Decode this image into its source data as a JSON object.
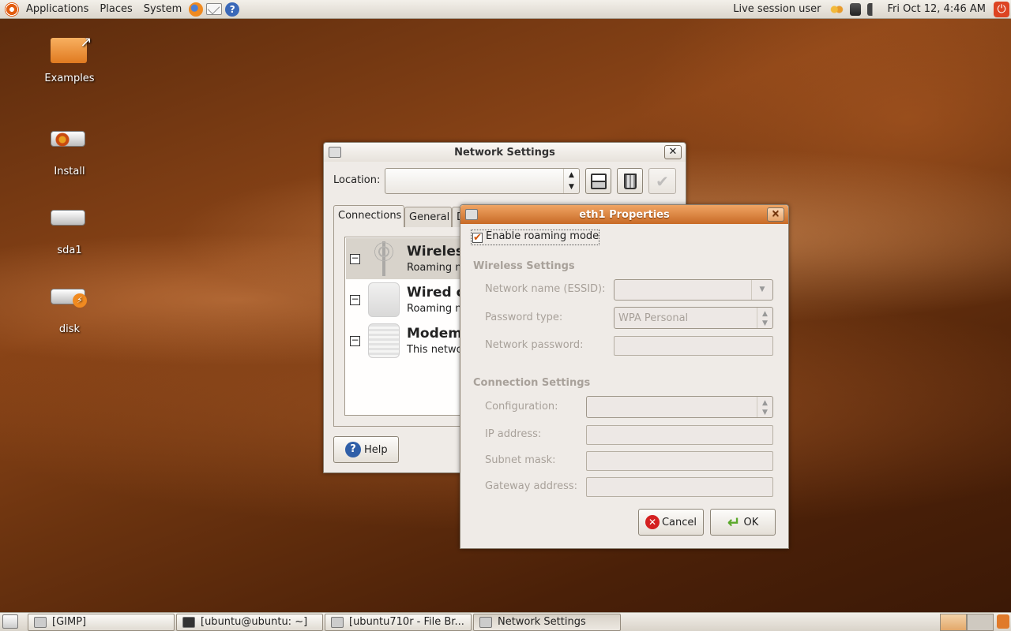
{
  "top_panel": {
    "menus": [
      "Applications",
      "Places",
      "System"
    ],
    "user_label": "Live session user",
    "clock": "Fri Oct 12,  4:46 AM"
  },
  "desktop": {
    "icons": [
      {
        "label": "Examples"
      },
      {
        "label": "Install"
      },
      {
        "label": "sda1"
      },
      {
        "label": "disk"
      }
    ]
  },
  "network_settings": {
    "title": "Network Settings",
    "location_label": "Location:",
    "location_value": "",
    "tabs": [
      "Connections",
      "General",
      "D"
    ],
    "connections": [
      {
        "title": "Wireless",
        "subtitle": "Roaming m"
      },
      {
        "title": "Wired c",
        "subtitle": "Roaming m"
      },
      {
        "title": "Modem",
        "subtitle": "This netwo"
      }
    ],
    "help_label": "Help"
  },
  "eth1_properties": {
    "title": "eth1 Properties",
    "roaming_label": "Enable roaming mode",
    "roaming_checked": true,
    "wireless_section": "Wireless Settings",
    "essid_label": "Network name (ESSID):",
    "essid_value": "",
    "password_type_label": "Password type:",
    "password_type_value": "WPA Personal",
    "network_password_label": "Network password:",
    "network_password_value": "",
    "connection_section": "Connection Settings",
    "configuration_label": "Configuration:",
    "configuration_value": "",
    "ip_label": "IP address:",
    "subnet_label": "Subnet mask:",
    "gateway_label": "Gateway address:",
    "cancel_label": "Cancel",
    "ok_label": "OK"
  },
  "taskbar": {
    "tasks": [
      {
        "label": "[GIMP]"
      },
      {
        "label": "[ubuntu@ubuntu: ~]"
      },
      {
        "label": "[ubuntu710r - File Br..."
      },
      {
        "label": "Network Settings"
      }
    ]
  },
  "colors": {
    "titlebar_active": "#c86a26",
    "desktop_base": "#6b330f",
    "panel": "#dcd6cc"
  }
}
